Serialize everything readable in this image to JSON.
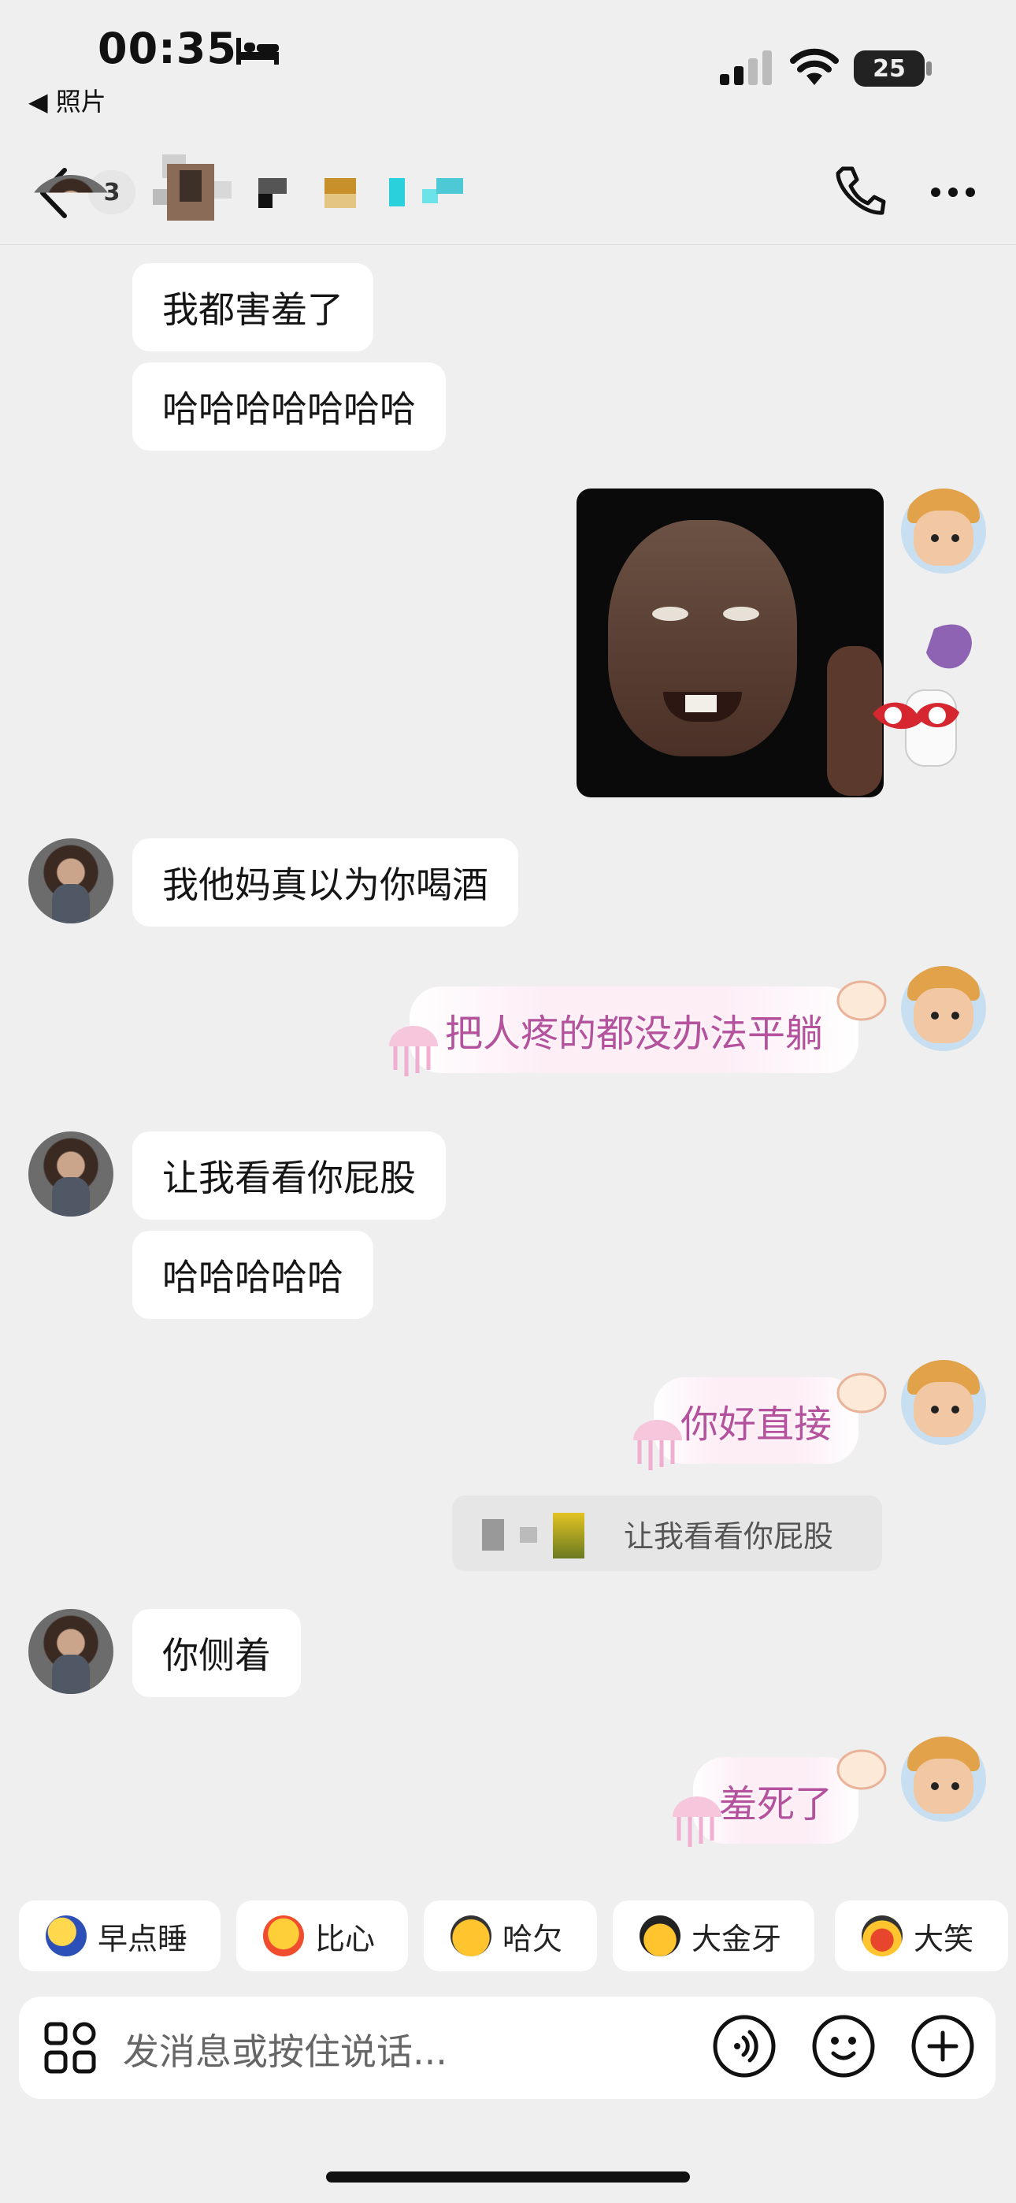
{
  "status_bar": {
    "time": "00:35",
    "back_app": "◀ 照片",
    "battery": "25"
  },
  "header": {
    "unread_count": "3"
  },
  "messages": [
    {
      "side": "left",
      "text": "我都害羞了"
    },
    {
      "side": "left",
      "text": "哈哈哈哈哈哈哈"
    },
    {
      "side": "right",
      "type": "image"
    },
    {
      "side": "left",
      "text": "我他妈真以为你喝酒"
    },
    {
      "side": "right",
      "type": "sticker",
      "text": "把人疼的都没办法平躺"
    },
    {
      "side": "left",
      "text": "让我看看你屁股"
    },
    {
      "side": "left",
      "text": "哈哈哈哈哈"
    },
    {
      "side": "right",
      "type": "sticker",
      "text": "你好直接"
    },
    {
      "side": "right",
      "type": "quote",
      "text": "让我看看你屁股"
    },
    {
      "side": "left",
      "text": "你侧着"
    },
    {
      "side": "right",
      "type": "sticker",
      "text": "羞死了"
    }
  ],
  "quick_replies": [
    "早点睡",
    "比心",
    "哈欠",
    "大金牙",
    "大笑"
  ],
  "input": {
    "placeholder": "发消息或按住说话..."
  },
  "colors": {
    "background": "#efefef",
    "bubble": "#ffffff",
    "sticker_text": "#b5529e"
  }
}
